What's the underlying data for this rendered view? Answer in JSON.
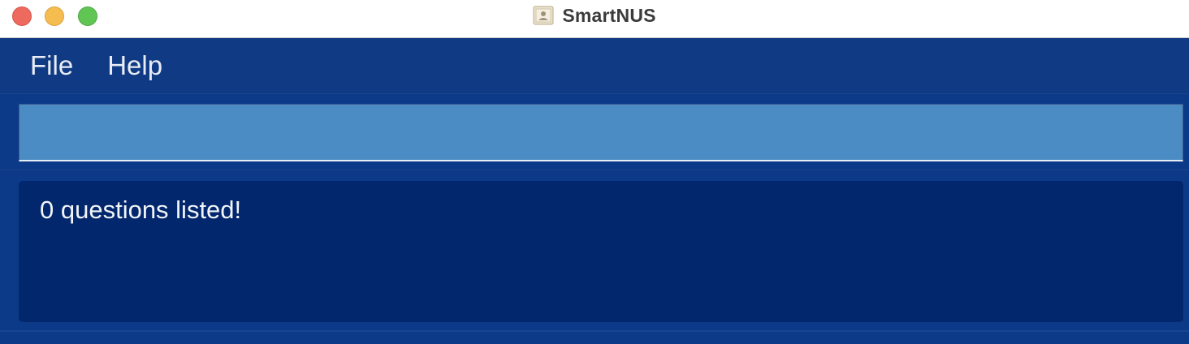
{
  "window": {
    "title": "SmartNUS",
    "app_icon": "contact-card-icon",
    "controls": [
      "close",
      "minimize",
      "maximize"
    ]
  },
  "menu": {
    "items": [
      {
        "label": "File"
      },
      {
        "label": "Help"
      }
    ]
  },
  "command_box": {
    "value": "",
    "placeholder": ""
  },
  "result_display": {
    "text": "0 questions listed!"
  },
  "colors": {
    "background": "#0f3680",
    "command_box": "#4b8cc4",
    "result_box": "#02276d",
    "text": "#f2f4f8"
  }
}
